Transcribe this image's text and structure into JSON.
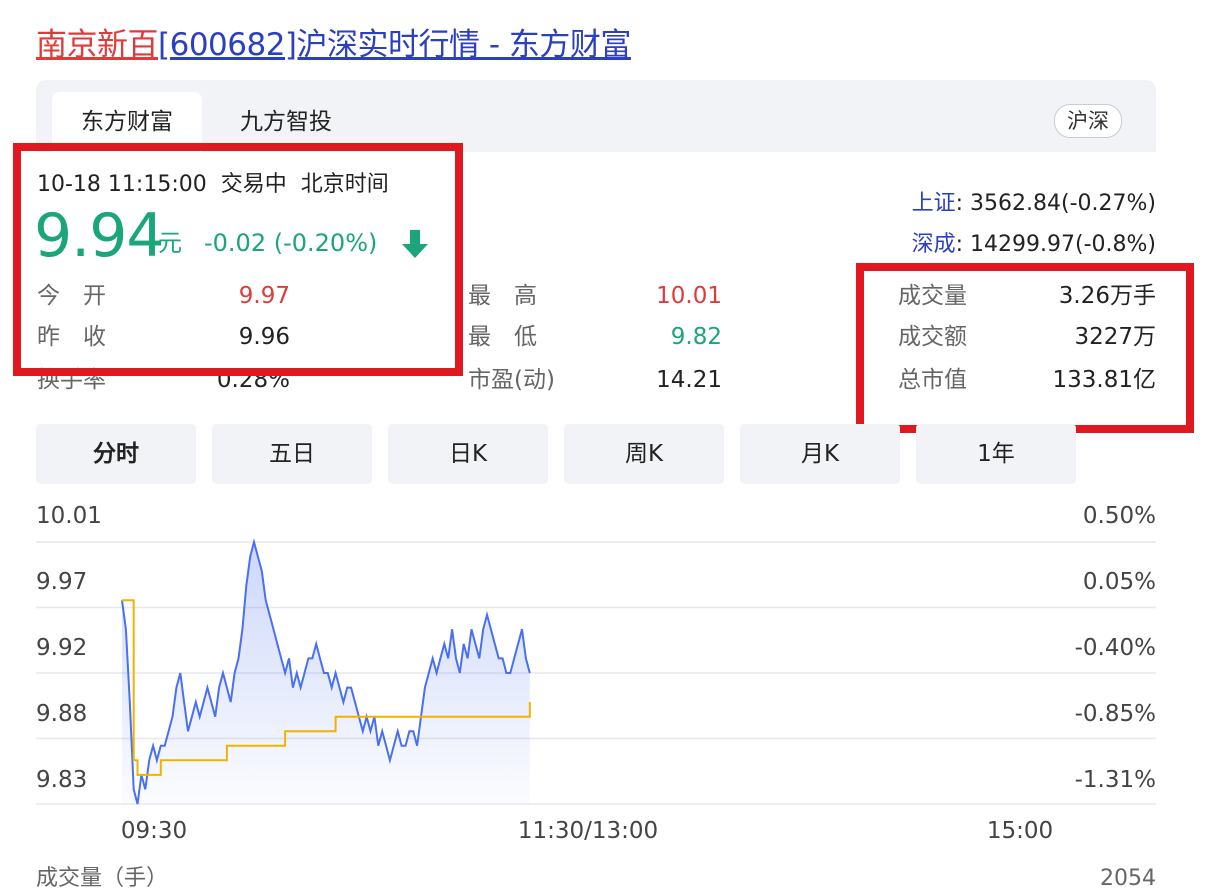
{
  "title": {
    "stock": "南京新百",
    "rest": "[600682]沪深实时行情 - 东方财富"
  },
  "tabs": [
    {
      "label": "东方财富"
    },
    {
      "label": "九方智投"
    }
  ],
  "market_pill": "沪深",
  "quote": {
    "date_time": "10-18 11:15:00",
    "status": "交易中",
    "timezone": "北京时间",
    "price": "9.94",
    "unit": "元",
    "change": "-0.02 (-0.20%)",
    "direction_icon": "arrow-down-icon",
    "open": {
      "label": "今　开",
      "value": "9.97"
    },
    "prev_close": {
      "label": "昨　收",
      "value": "9.96"
    },
    "turnover": {
      "label": "换手率",
      "value": "0.28%"
    },
    "high": {
      "label": "最　高",
      "value": "10.01"
    },
    "low": {
      "label": "最　低",
      "value": "9.82"
    },
    "pe": {
      "label": "市盈(动)",
      "value": "14.21"
    },
    "volume": {
      "label": "成交量",
      "value": "3.26万手"
    },
    "amount": {
      "label": "成交额",
      "value": "3227万"
    },
    "market_cap": {
      "label": "总市值",
      "value": "133.81亿"
    }
  },
  "indices": {
    "sh": {
      "name": "上证",
      "value": ": 3562.84(-0.27%)"
    },
    "sz": {
      "name": "深成",
      "value": ": 14299.97(-0.8%)"
    }
  },
  "period_buttons": [
    "分时",
    "五日",
    "日K",
    "周K",
    "月K",
    "1年"
  ],
  "colors": {
    "up": "#e03a3a",
    "down": "#1aa57a",
    "link": "#2b3fbf",
    "price_line": "#4a6ff0",
    "avg_line": "#f0b400",
    "highlight_box": "#e01820"
  },
  "chart_data": {
    "type": "line",
    "title": "",
    "x_ticks": [
      "09:30",
      "11:30/13:00",
      "15:00"
    ],
    "y_ticks_left": [
      "10.01",
      "9.97",
      "9.92",
      "9.88",
      "9.83"
    ],
    "y_ticks_right": [
      "0.50%",
      "0.05%",
      "-0.40%",
      "-0.85%",
      "-1.31%"
    ],
    "ylim": [
      9.83,
      10.01
    ],
    "minutes_total": 240,
    "series": [
      {
        "name": "",
        "x": [
          0,
          1,
          2,
          3,
          4,
          5,
          6,
          7,
          8,
          9,
          10,
          11,
          12,
          13,
          14,
          15,
          16,
          17,
          18,
          19,
          20,
          21,
          22,
          23,
          24,
          25,
          26,
          27,
          28,
          29,
          30,
          31,
          32,
          33,
          34,
          35,
          36,
          37,
          38,
          39,
          40,
          41,
          42,
          43,
          44,
          45,
          46,
          47,
          48,
          49,
          50,
          51,
          52,
          53,
          54,
          55,
          56,
          57,
          58,
          59,
          60,
          61,
          62,
          63,
          64,
          65,
          66,
          67,
          68,
          69,
          70,
          71,
          72,
          73,
          74,
          75,
          76,
          77,
          78,
          79,
          80,
          81,
          82,
          83,
          84,
          85,
          86,
          87,
          88,
          89,
          90,
          91,
          92,
          93,
          94,
          95,
          96,
          97,
          98,
          99,
          100,
          101,
          102,
          103,
          104,
          105
        ],
        "values": [
          9.97,
          9.95,
          9.9,
          9.84,
          9.83,
          9.85,
          9.84,
          9.86,
          9.87,
          9.86,
          9.87,
          9.87,
          9.88,
          9.89,
          9.91,
          9.92,
          9.9,
          9.88,
          9.89,
          9.9,
          9.89,
          9.9,
          9.91,
          9.9,
          9.89,
          9.91,
          9.92,
          9.91,
          9.9,
          9.92,
          9.93,
          9.95,
          9.98,
          10.0,
          10.01,
          10.0,
          9.99,
          9.97,
          9.96,
          9.95,
          9.94,
          9.93,
          9.92,
          9.93,
          9.91,
          9.92,
          9.91,
          9.92,
          9.93,
          9.93,
          9.94,
          9.93,
          9.92,
          9.92,
          9.91,
          9.92,
          9.91,
          9.9,
          9.91,
          9.91,
          9.9,
          9.89,
          9.88,
          9.89,
          9.88,
          9.89,
          9.87,
          9.88,
          9.87,
          9.86,
          9.87,
          9.88,
          9.87,
          9.87,
          9.88,
          9.88,
          9.87,
          9.89,
          9.91,
          9.92,
          9.93,
          9.92,
          9.93,
          9.94,
          9.93,
          9.95,
          9.93,
          9.92,
          9.94,
          9.93,
          9.95,
          9.94,
          9.93,
          9.95,
          9.96,
          9.95,
          9.94,
          9.93,
          9.93,
          9.92,
          9.92,
          9.93,
          9.94,
          9.95,
          9.93,
          9.92
        ]
      },
      {
        "name": "",
        "x": [
          0,
          3,
          4,
          6,
          7,
          10,
          12,
          14,
          17,
          20,
          22,
          25,
          27,
          30,
          34,
          38,
          42,
          46,
          50,
          55,
          60,
          65,
          70,
          75,
          80,
          85,
          90,
          95,
          100,
          105
        ],
        "values": [
          9.97,
          9.86,
          9.85,
          9.85,
          9.85,
          9.86,
          9.86,
          9.86,
          9.86,
          9.86,
          9.86,
          9.86,
          9.87,
          9.87,
          9.87,
          9.87,
          9.88,
          9.88,
          9.88,
          9.89,
          9.89,
          9.89,
          9.89,
          9.89,
          9.89,
          9.89,
          9.89,
          9.89,
          9.89,
          9.9
        ]
      }
    ],
    "volume_label": "成交量（手）",
    "volume_max": "2054"
  }
}
